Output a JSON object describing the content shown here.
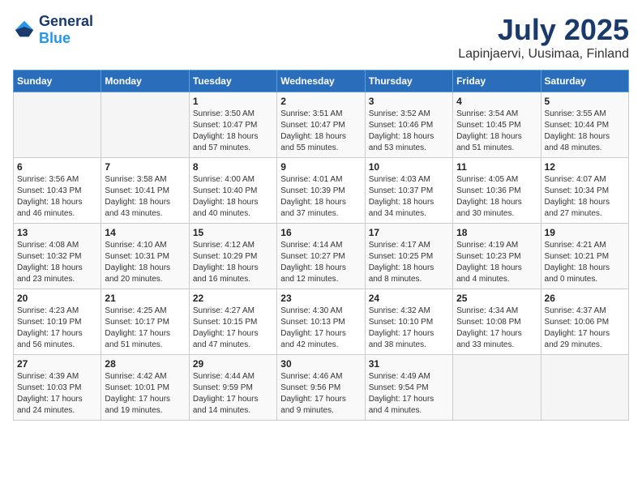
{
  "header": {
    "logo_general": "General",
    "logo_blue": "Blue",
    "title": "July 2025",
    "subtitle": "Lapinjaervi, Uusimaa, Finland"
  },
  "calendar": {
    "days_of_week": [
      "Sunday",
      "Monday",
      "Tuesday",
      "Wednesday",
      "Thursday",
      "Friday",
      "Saturday"
    ],
    "weeks": [
      [
        {
          "day": "",
          "info": ""
        },
        {
          "day": "",
          "info": ""
        },
        {
          "day": "1",
          "info": "Sunrise: 3:50 AM\nSunset: 10:47 PM\nDaylight: 18 hours\nand 57 minutes."
        },
        {
          "day": "2",
          "info": "Sunrise: 3:51 AM\nSunset: 10:47 PM\nDaylight: 18 hours\nand 55 minutes."
        },
        {
          "day": "3",
          "info": "Sunrise: 3:52 AM\nSunset: 10:46 PM\nDaylight: 18 hours\nand 53 minutes."
        },
        {
          "day": "4",
          "info": "Sunrise: 3:54 AM\nSunset: 10:45 PM\nDaylight: 18 hours\nand 51 minutes."
        },
        {
          "day": "5",
          "info": "Sunrise: 3:55 AM\nSunset: 10:44 PM\nDaylight: 18 hours\nand 48 minutes."
        }
      ],
      [
        {
          "day": "6",
          "info": "Sunrise: 3:56 AM\nSunset: 10:43 PM\nDaylight: 18 hours\nand 46 minutes."
        },
        {
          "day": "7",
          "info": "Sunrise: 3:58 AM\nSunset: 10:41 PM\nDaylight: 18 hours\nand 43 minutes."
        },
        {
          "day": "8",
          "info": "Sunrise: 4:00 AM\nSunset: 10:40 PM\nDaylight: 18 hours\nand 40 minutes."
        },
        {
          "day": "9",
          "info": "Sunrise: 4:01 AM\nSunset: 10:39 PM\nDaylight: 18 hours\nand 37 minutes."
        },
        {
          "day": "10",
          "info": "Sunrise: 4:03 AM\nSunset: 10:37 PM\nDaylight: 18 hours\nand 34 minutes."
        },
        {
          "day": "11",
          "info": "Sunrise: 4:05 AM\nSunset: 10:36 PM\nDaylight: 18 hours\nand 30 minutes."
        },
        {
          "day": "12",
          "info": "Sunrise: 4:07 AM\nSunset: 10:34 PM\nDaylight: 18 hours\nand 27 minutes."
        }
      ],
      [
        {
          "day": "13",
          "info": "Sunrise: 4:08 AM\nSunset: 10:32 PM\nDaylight: 18 hours\nand 23 minutes."
        },
        {
          "day": "14",
          "info": "Sunrise: 4:10 AM\nSunset: 10:31 PM\nDaylight: 18 hours\nand 20 minutes."
        },
        {
          "day": "15",
          "info": "Sunrise: 4:12 AM\nSunset: 10:29 PM\nDaylight: 18 hours\nand 16 minutes."
        },
        {
          "day": "16",
          "info": "Sunrise: 4:14 AM\nSunset: 10:27 PM\nDaylight: 18 hours\nand 12 minutes."
        },
        {
          "day": "17",
          "info": "Sunrise: 4:17 AM\nSunset: 10:25 PM\nDaylight: 18 hours\nand 8 minutes."
        },
        {
          "day": "18",
          "info": "Sunrise: 4:19 AM\nSunset: 10:23 PM\nDaylight: 18 hours\nand 4 minutes."
        },
        {
          "day": "19",
          "info": "Sunrise: 4:21 AM\nSunset: 10:21 PM\nDaylight: 18 hours\nand 0 minutes."
        }
      ],
      [
        {
          "day": "20",
          "info": "Sunrise: 4:23 AM\nSunset: 10:19 PM\nDaylight: 17 hours\nand 56 minutes."
        },
        {
          "day": "21",
          "info": "Sunrise: 4:25 AM\nSunset: 10:17 PM\nDaylight: 17 hours\nand 51 minutes."
        },
        {
          "day": "22",
          "info": "Sunrise: 4:27 AM\nSunset: 10:15 PM\nDaylight: 17 hours\nand 47 minutes."
        },
        {
          "day": "23",
          "info": "Sunrise: 4:30 AM\nSunset: 10:13 PM\nDaylight: 17 hours\nand 42 minutes."
        },
        {
          "day": "24",
          "info": "Sunrise: 4:32 AM\nSunset: 10:10 PM\nDaylight: 17 hours\nand 38 minutes."
        },
        {
          "day": "25",
          "info": "Sunrise: 4:34 AM\nSunset: 10:08 PM\nDaylight: 17 hours\nand 33 minutes."
        },
        {
          "day": "26",
          "info": "Sunrise: 4:37 AM\nSunset: 10:06 PM\nDaylight: 17 hours\nand 29 minutes."
        }
      ],
      [
        {
          "day": "27",
          "info": "Sunrise: 4:39 AM\nSunset: 10:03 PM\nDaylight: 17 hours\nand 24 minutes."
        },
        {
          "day": "28",
          "info": "Sunrise: 4:42 AM\nSunset: 10:01 PM\nDaylight: 17 hours\nand 19 minutes."
        },
        {
          "day": "29",
          "info": "Sunrise: 4:44 AM\nSunset: 9:59 PM\nDaylight: 17 hours\nand 14 minutes."
        },
        {
          "day": "30",
          "info": "Sunrise: 4:46 AM\nSunset: 9:56 PM\nDaylight: 17 hours\nand 9 minutes."
        },
        {
          "day": "31",
          "info": "Sunrise: 4:49 AM\nSunset: 9:54 PM\nDaylight: 17 hours\nand 4 minutes."
        },
        {
          "day": "",
          "info": ""
        },
        {
          "day": "",
          "info": ""
        }
      ]
    ]
  }
}
